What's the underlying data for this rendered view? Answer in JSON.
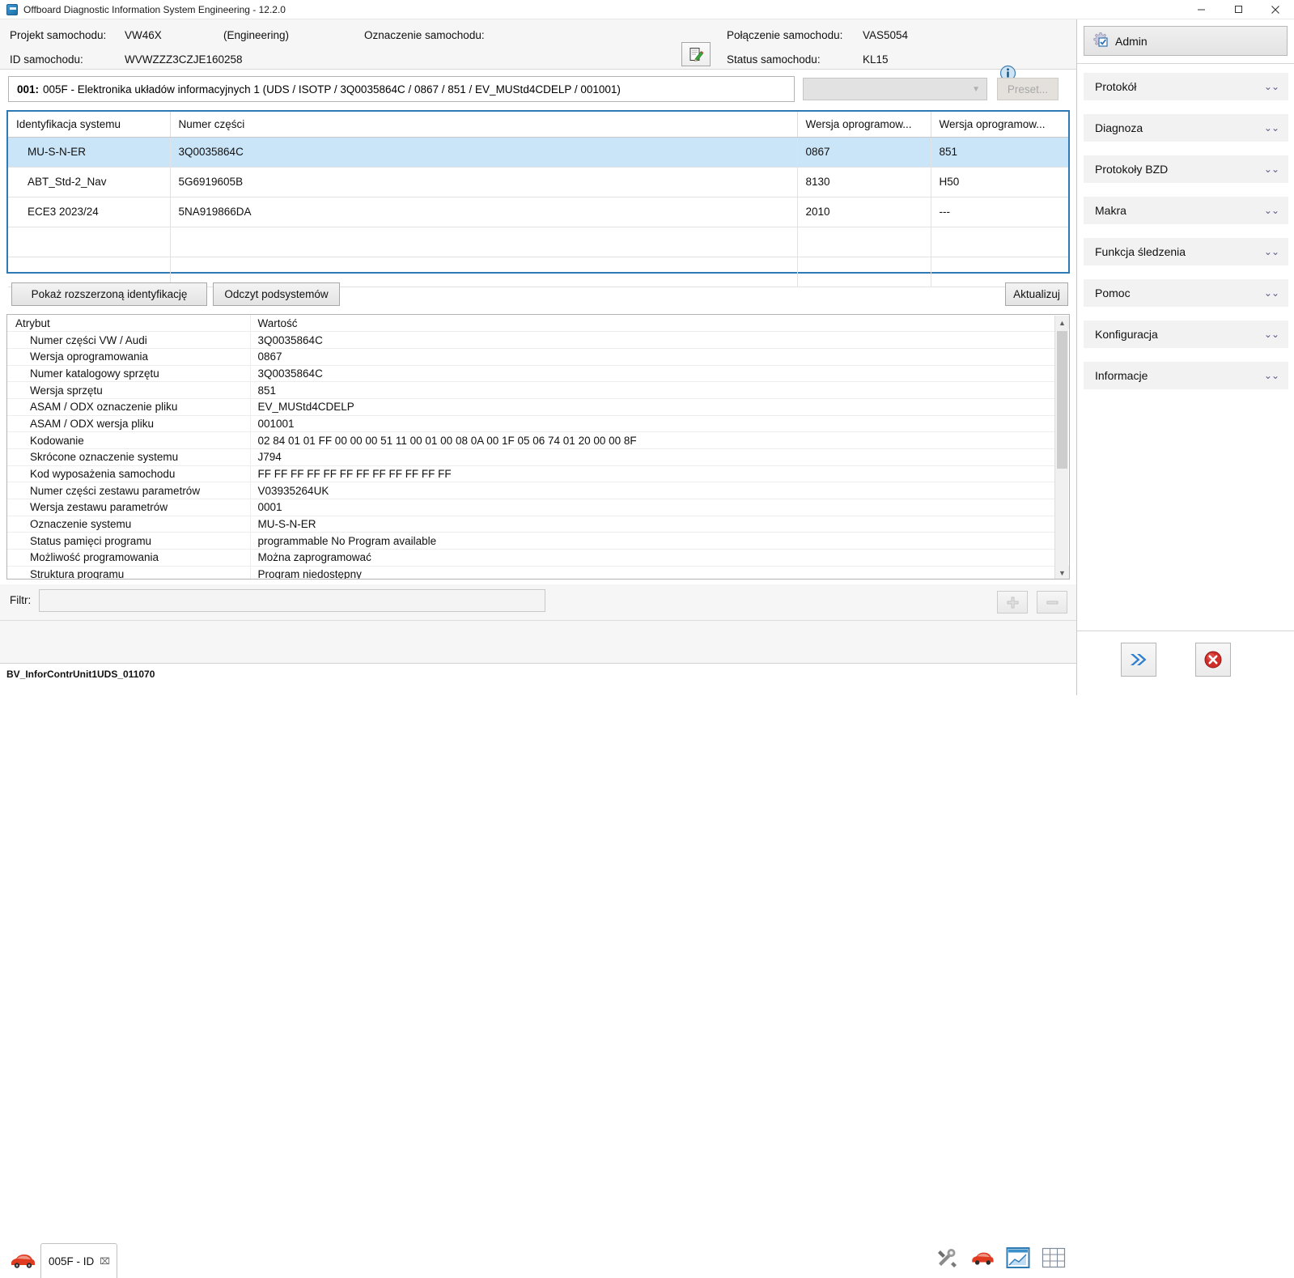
{
  "window": {
    "title": "Offboard Diagnostic Information System Engineering - 12.2.0",
    "minimize": "─",
    "maximize": "☐",
    "close": "✕"
  },
  "header": {
    "project_label": "Projekt samochodu:",
    "project_value": "VW46X",
    "project_mode": "(Engineering)",
    "vin_label": "ID samochodu:",
    "vin_value": "WVWZZZ3CZJE160258",
    "designation_label": "Oznaczenie samochodu:",
    "designation_value": "",
    "connection_label": "Połączenie samochodu:",
    "connection_value": "VAS5054",
    "status_label": "Status samochodu:",
    "status_value": "KL15",
    "note_icon": "notepad-pencil-icon",
    "info_icon": "info-icon"
  },
  "ecu_bar": {
    "number": "001:",
    "text": "005F - Elektronika układów informacyjnych 1  (UDS / ISOTP / 3Q0035864C / 0867 / 851 / EV_MUStd4CDELP / 001001)",
    "preset_combo_value": "",
    "preset_button": "Preset..."
  },
  "system_table": {
    "columns": [
      "Identyfikacja systemu",
      "Numer części",
      "Wersja oprogramow...",
      "Wersja oprogramow..."
    ],
    "rows": [
      {
        "system": "MU-S-N-ER",
        "part": "3Q0035864C",
        "sw1": "0867",
        "sw2": "851",
        "selected": true
      },
      {
        "system": "ABT_Std-2_Nav",
        "part": "5G6919605B",
        "sw1": "8130",
        "sw2": "H50",
        "selected": false
      },
      {
        "system": "ECE3 2023/24",
        "part": "5NA919866DA",
        "sw1": "2010",
        "sw2": "---",
        "selected": false
      },
      {
        "system": "",
        "part": "",
        "sw1": "",
        "sw2": "",
        "selected": false
      },
      {
        "system": "",
        "part": "",
        "sw1": "",
        "sw2": "",
        "selected": false
      }
    ]
  },
  "actions": {
    "show_extended": "Pokaż rozszerzoną identyfikację",
    "read_subsystems": "Odczyt podsystemów",
    "update": "Aktualizuj"
  },
  "attributes": {
    "header_key": "Atrybut",
    "header_value": "Wartość",
    "rows": [
      {
        "key": "Numer części VW / Audi",
        "value": "3Q0035864C"
      },
      {
        "key": "Wersja oprogramowania",
        "value": "0867"
      },
      {
        "key": "Numer katalogowy sprzętu",
        "value": "3Q0035864C"
      },
      {
        "key": "Wersja sprzętu",
        "value": "851"
      },
      {
        "key": "ASAM / ODX oznaczenie pliku",
        "value": "EV_MUStd4CDELP"
      },
      {
        "key": "ASAM / ODX wersja pliku",
        "value": "001001"
      },
      {
        "key": "Kodowanie",
        "value": "02 84 01 01 FF 00 00 00 51 11 00 01 00 08 0A 00 1F 05 06 74 01 20 00 00 8F"
      },
      {
        "key": "Skrócone oznaczenie systemu",
        "value": "J794"
      },
      {
        "key": "Kod wyposażenia samochodu",
        "value": "FF FF FF FF FF FF FF FF FF FF FF FF"
      },
      {
        "key": "Numer części zestawu parametrów",
        "value": "V03935264UK"
      },
      {
        "key": "Wersja zestawu parametrów",
        "value": "0001"
      },
      {
        "key": "Oznaczenie systemu",
        "value": "MU-S-N-ER"
      },
      {
        "key": "Status pamięci programu",
        "value": "programmable No Program available"
      },
      {
        "key": "Możliwość programowania",
        "value": "Można zaprogramować"
      },
      {
        "key": "Struktura programu",
        "value": "Program niedostępny"
      }
    ]
  },
  "filter": {
    "label": "Filtr:",
    "value": "",
    "placeholder": "",
    "add_icon": "plus-icon",
    "remove_icon": "minus-icon"
  },
  "tabbar": {
    "car_icon": "red-car-icon",
    "tab_label": "005F - ID",
    "tab_close": "⌧",
    "icons": [
      "tools-icon",
      "red-car-icon",
      "chart-window-icon",
      "grid-table-icon"
    ]
  },
  "statusbar": {
    "text": "BV_InforContrUnit1UDS_011070"
  },
  "sidebar": {
    "user": "Admin",
    "user_icon": "gear-check-icon",
    "items": [
      {
        "label": "Protokół",
        "chevron": "»"
      },
      {
        "label": "Diagnoza",
        "chevron": "»"
      },
      {
        "label": "Protokoły BZD",
        "chevron": "»"
      },
      {
        "label": "Makra",
        "chevron": "»"
      },
      {
        "label": "Funkcja śledzenia",
        "chevron": "»"
      },
      {
        "label": "Pomoc",
        "chevron": "»"
      },
      {
        "label": "Konfiguracja",
        "chevron": "»"
      },
      {
        "label": "Informacje",
        "chevron": "»"
      }
    ],
    "forward_icon": "double-chevron-right-icon",
    "close_icon": "red-x-circle-icon"
  },
  "colors": {
    "selection": "#cbe5f8",
    "table_border": "#2e7ab5",
    "accent_blue": "#1d6fa8"
  }
}
